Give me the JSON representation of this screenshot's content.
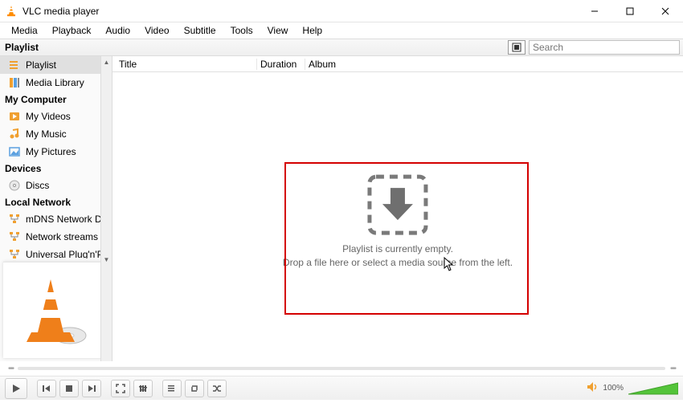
{
  "titlebar": {
    "title": "VLC media player"
  },
  "menu": [
    "Media",
    "Playback",
    "Audio",
    "Video",
    "Subtitle",
    "Tools",
    "View",
    "Help"
  ],
  "toolbar": {
    "playlist_label": "Playlist",
    "search_placeholder": "Search"
  },
  "sidebar": {
    "playlist_header": null,
    "items_top": [
      {
        "label": "Playlist",
        "icon": "playlist-icon",
        "selected": true
      },
      {
        "label": "Media Library",
        "icon": "media-library-icon",
        "selected": false
      }
    ],
    "mycomputer_header": "My Computer",
    "items_mycomputer": [
      {
        "label": "My Videos",
        "icon": "video-icon"
      },
      {
        "label": "My Music",
        "icon": "music-icon"
      },
      {
        "label": "My Pictures",
        "icon": "pictures-icon"
      }
    ],
    "devices_header": "Devices",
    "items_devices": [
      {
        "label": "Discs",
        "icon": "disc-icon"
      }
    ],
    "localnet_header": "Local Network",
    "items_localnet": [
      {
        "label": "mDNS Network Disco...",
        "icon": "network-icon"
      },
      {
        "label": "Network streams (SAP)",
        "icon": "network-icon"
      },
      {
        "label": "Universal Plug'n'Play",
        "icon": "network-icon"
      }
    ]
  },
  "columns": {
    "title": "Title",
    "duration": "Duration",
    "album": "Album"
  },
  "empty": {
    "line1": "Playlist is currently empty.",
    "line2": "Drop a file here or select a media source from the left."
  },
  "controls": {
    "volume_label": "100%"
  }
}
